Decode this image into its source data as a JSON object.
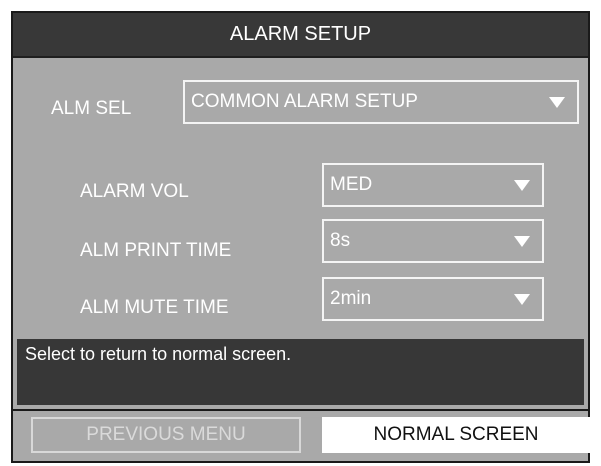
{
  "title": "ALARM SETUP",
  "alm_sel": {
    "label": "ALM SEL",
    "value": "COMMON ALARM SETUP"
  },
  "settings": [
    {
      "label": "ALARM VOL",
      "value": "MED"
    },
    {
      "label": "ALM PRINT TIME",
      "value": "8s"
    },
    {
      "label": "ALM MUTE TIME",
      "value": "2min"
    }
  ],
  "help_text": "Select to return to normal screen.",
  "footer": {
    "previous_label": "PREVIOUS MENU",
    "normal_label": "NORMAL SCREEN"
  },
  "colors": {
    "panel": "#a9a9a9",
    "title_bar": "#383838",
    "help_bar": "#373737",
    "highlight_button": "#ffffff"
  }
}
